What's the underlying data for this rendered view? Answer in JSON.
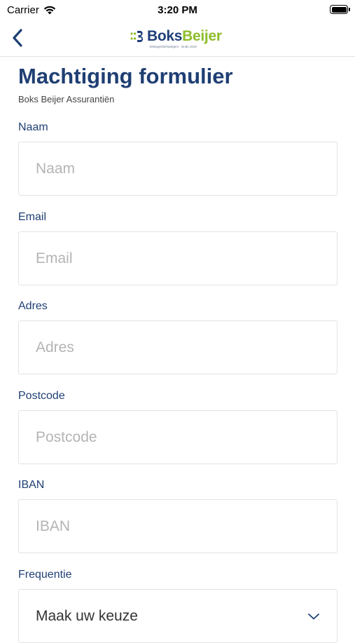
{
  "status_bar": {
    "carrier": "Carrier",
    "time": "3:20 PM"
  },
  "header": {
    "logo_text_part1": "Boks",
    "logo_text_part2": "Beijer",
    "logo_tagline": "belangenbehartigers · sinds 1919",
    "brand_colors": {
      "primary": "#1f3f7a",
      "accent": "#8dbd2b"
    }
  },
  "page": {
    "title": "Machtiging formulier",
    "subtitle": "Boks Beijer Assurantiën"
  },
  "form": {
    "fields": [
      {
        "label": "Naam",
        "placeholder": "Naam",
        "value": ""
      },
      {
        "label": "Email",
        "placeholder": "Email",
        "value": ""
      },
      {
        "label": "Adres",
        "placeholder": "Adres",
        "value": ""
      },
      {
        "label": "Postcode",
        "placeholder": "Postcode",
        "value": ""
      },
      {
        "label": "IBAN",
        "placeholder": "IBAN",
        "value": ""
      }
    ],
    "frequency": {
      "label": "Frequentie",
      "selected": "Maak uw keuze"
    }
  }
}
